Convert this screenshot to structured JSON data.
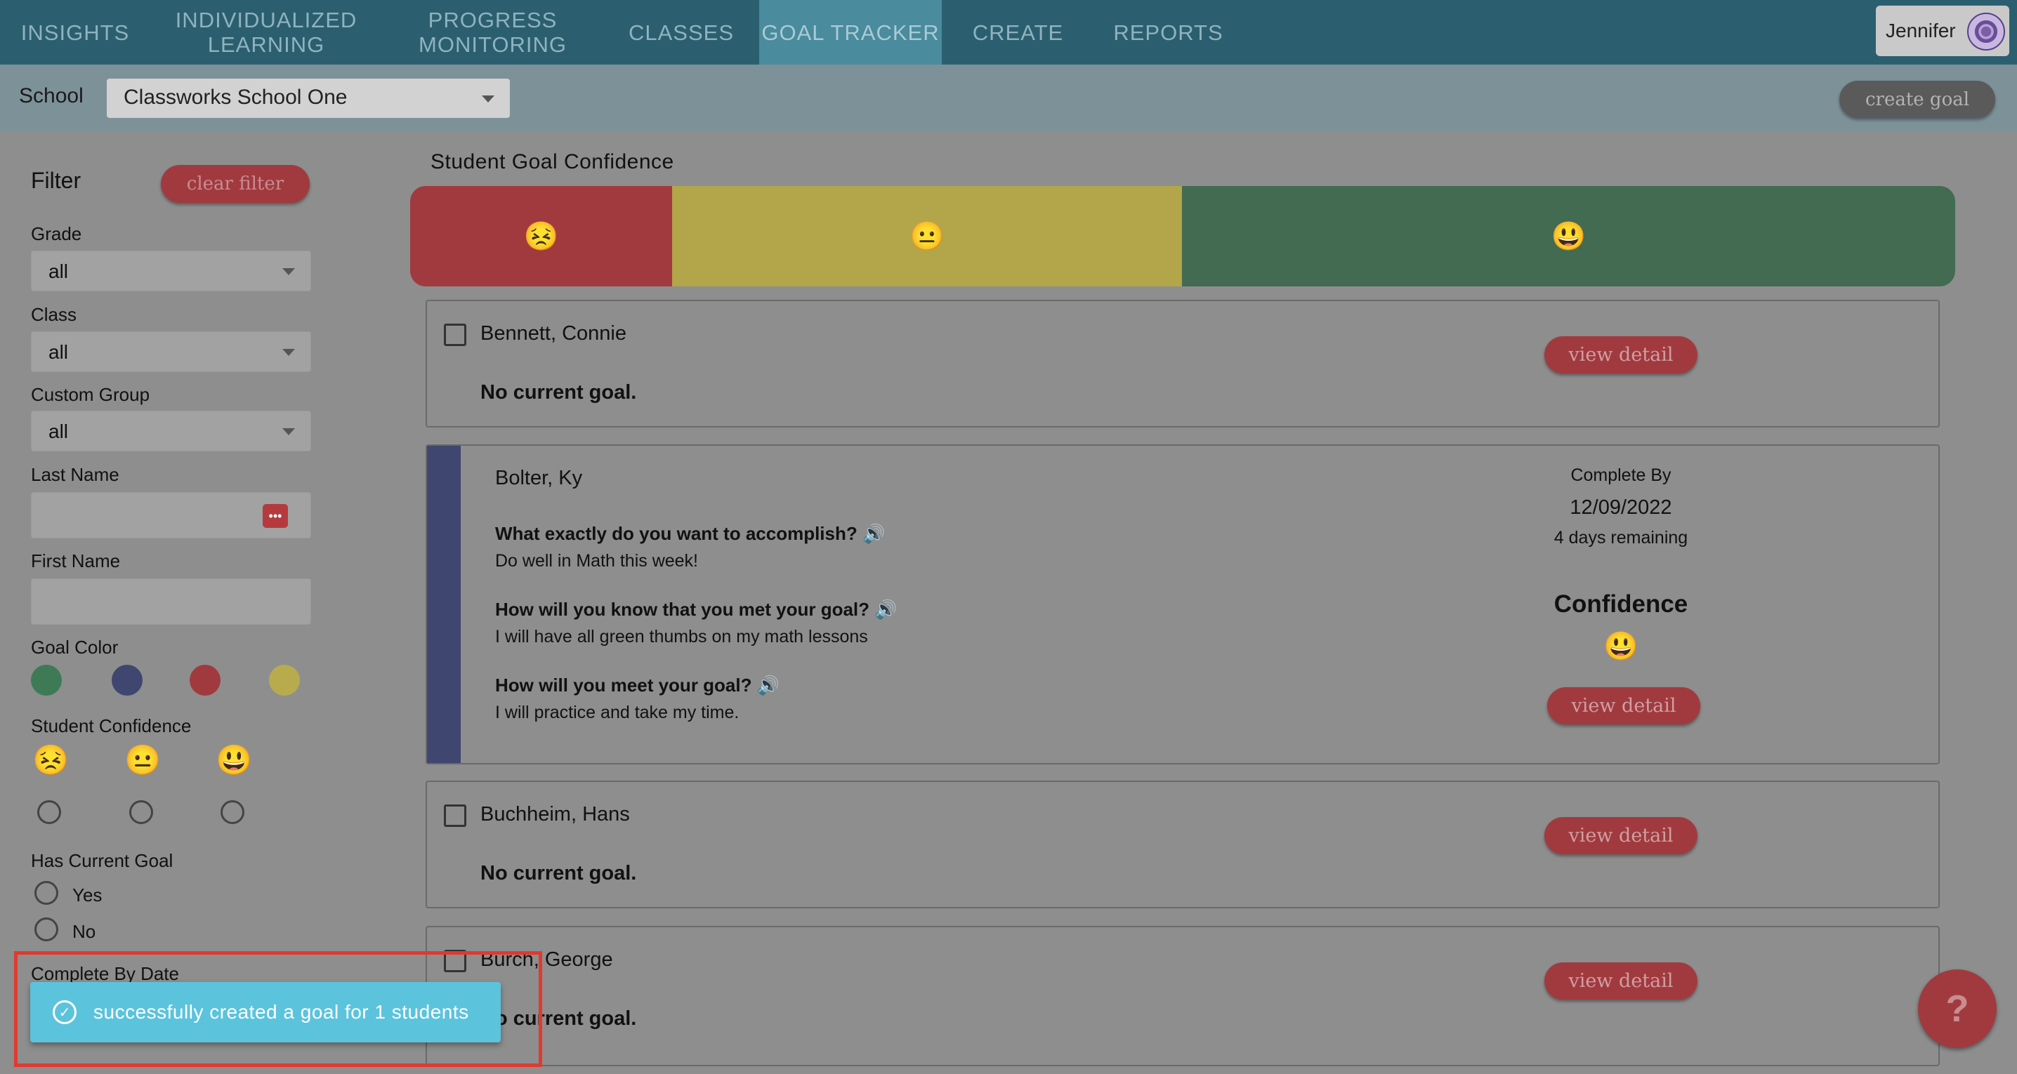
{
  "nav": {
    "items": [
      {
        "label": "INSIGHTS"
      },
      {
        "label": "INDIVIDUALIZED\nLEARNING"
      },
      {
        "label": "PROGRESS\nMONITORING"
      },
      {
        "label": "CLASSES"
      },
      {
        "label": "GOAL TRACKER"
      },
      {
        "label": "CREATE"
      },
      {
        "label": "REPORTS"
      }
    ],
    "active": "GOAL TRACKER",
    "user_name": "Jennifer"
  },
  "school_bar": {
    "label": "School",
    "selected_school": "Classworks School One",
    "create_goal_label": "create goal"
  },
  "filter": {
    "title": "Filter",
    "clear_label": "clear filter",
    "grade": {
      "label": "Grade",
      "value": "all"
    },
    "class": {
      "label": "Class",
      "value": "all"
    },
    "custom_group": {
      "label": "Custom Group",
      "value": "all"
    },
    "last_name": {
      "label": "Last Name",
      "value": ""
    },
    "first_name": {
      "label": "First Name",
      "value": ""
    },
    "goal_color": {
      "label": "Goal Color",
      "colors": [
        "#3f7a57",
        "#3f4670",
        "#a13a3f",
        "#b8ab4e"
      ]
    },
    "student_confidence": {
      "label": "Student Confidence",
      "options": [
        "😣",
        "😐",
        "😃"
      ]
    },
    "has_current_goal": {
      "label": "Has Current Goal",
      "options": [
        "Yes",
        "No"
      ]
    },
    "complete_by_date": {
      "label": "Complete By Date"
    }
  },
  "confidence": {
    "title": "Student Goal Confidence",
    "segments": [
      {
        "emoji": "😣",
        "color": "#a13a3f"
      },
      {
        "emoji": "😐",
        "color": "#b3a54a"
      },
      {
        "emoji": "😃",
        "color": "#426b51"
      }
    ]
  },
  "students": [
    {
      "name": "Bennett, Connie",
      "goal_text": "No current goal.",
      "button": "view detail"
    },
    {
      "name": "Bolter, Ky",
      "questions": [
        {
          "q": "What exactly do you want to accomplish?",
          "a": "Do well in Math this week!"
        },
        {
          "q": "How will you know that you met your goal?",
          "a": "I will have all green thumbs on my math lessons"
        },
        {
          "q": "How will you meet your goal?",
          "a": "I will practice and take my time."
        }
      ],
      "complete_by_label": "Complete By",
      "complete_by_date": "12/09/2022",
      "remaining": "4 days remaining",
      "confidence_label": "Confidence",
      "confidence_emoji": "😃",
      "button": "view detail"
    },
    {
      "name": "Buchheim, Hans",
      "goal_text": "No current goal.",
      "button": "view detail"
    },
    {
      "name": "Burch, George",
      "goal_text": "No current goal.",
      "button": "view detail"
    }
  ],
  "toast": {
    "message": "successfully created a goal for 1 students"
  },
  "help_label": "?"
}
